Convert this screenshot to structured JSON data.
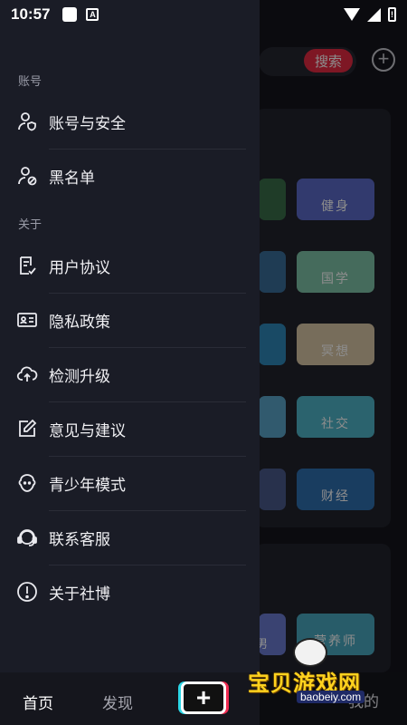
{
  "status_bar": {
    "time": "10:57",
    "badge_letter": "A",
    "battery_label": "!"
  },
  "background": {
    "search_button": "搜索",
    "tiles": [
      "健身",
      "国学",
      "冥想",
      "社交",
      "财经",
      "营养师"
    ],
    "bottom_mine": "我的",
    "edge_char": "男"
  },
  "drawer": {
    "sections": [
      {
        "label": "账号"
      },
      {
        "label": "关于"
      }
    ],
    "account_items": [
      {
        "label": "账号与安全",
        "icon": "user-shield-icon"
      },
      {
        "label": "黑名单",
        "icon": "user-block-icon"
      }
    ],
    "about_items": [
      {
        "label": "用户协议",
        "icon": "agreement-icon"
      },
      {
        "label": "隐私政策",
        "icon": "id-card-icon"
      },
      {
        "label": "检测升级",
        "icon": "cloud-upload-icon"
      },
      {
        "label": "意见与建议",
        "icon": "edit-icon"
      },
      {
        "label": "青少年模式",
        "icon": "teen-face-icon"
      },
      {
        "label": "联系客服",
        "icon": "headset-icon"
      },
      {
        "label": "关于社博",
        "icon": "info-icon"
      }
    ]
  },
  "bottom_nav": {
    "home": "首页",
    "discover": "发现",
    "add": "+"
  },
  "watermark": {
    "text": "宝贝游戏网",
    "url": "baobeiy.com"
  },
  "colors": {
    "accent": "#e52a43",
    "drawer_bg": "#1a1c26",
    "text": "#f1f1f4",
    "muted": "#9a9ca8"
  }
}
